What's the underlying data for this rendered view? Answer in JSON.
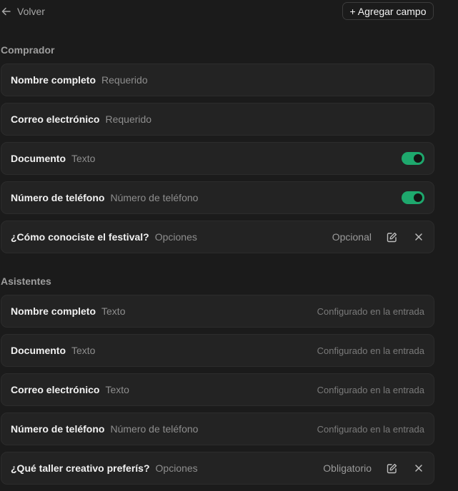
{
  "header": {
    "back_label": "Volver",
    "add_field_label": "+ Agregar campo"
  },
  "sections": {
    "buyer": {
      "title": "Comprador",
      "fields": [
        {
          "name": "Nombre completo",
          "type": "Requerido"
        },
        {
          "name": "Correo electrónico",
          "type": "Requerido"
        },
        {
          "name": "Documento",
          "type": "Texto",
          "enabled": true
        },
        {
          "name": "Número de teléfono",
          "type": "Número de teléfono",
          "enabled": true
        },
        {
          "name": "¿Cómo conociste el festival?",
          "type": "Opciones",
          "status": "Opcional"
        }
      ]
    },
    "attendees": {
      "title": "Asistentes",
      "fields": [
        {
          "name": "Nombre completo",
          "type": "Texto",
          "status": "Configurado en la entrada"
        },
        {
          "name": "Documento",
          "type": "Texto",
          "status": "Configurado en la entrada"
        },
        {
          "name": "Correo electrónico",
          "type": "Texto",
          "status": "Configurado en la entrada"
        },
        {
          "name": "Número de teléfono",
          "type": "Número de teléfono",
          "status": "Configurado en la entrada"
        },
        {
          "name": "¿Qué taller creativo preferís?",
          "type": "Opciones",
          "status": "Obligatorio"
        }
      ]
    }
  },
  "colors": {
    "background": "#1b1b1b",
    "row_background": "#232323",
    "toggle_on": "#1ea86d"
  },
  "icons": {
    "back": "arrow-left-icon",
    "edit": "edit-icon",
    "remove": "close-icon"
  }
}
